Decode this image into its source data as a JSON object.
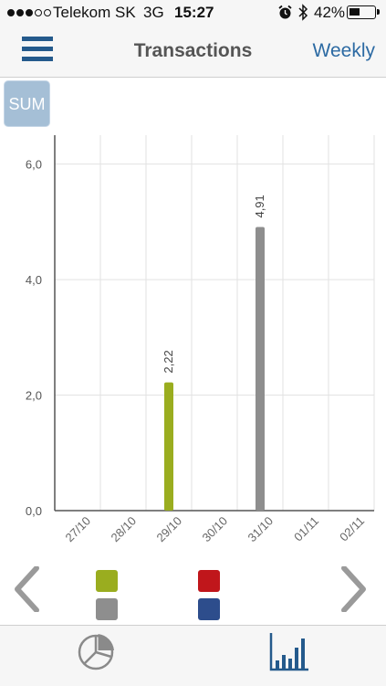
{
  "status_bar": {
    "signal_full": 3,
    "signal_total": 5,
    "carrier": "Telekom SK",
    "network": "3G",
    "time": "15:27",
    "icons": [
      "alarm-icon",
      "bluetooth-icon"
    ],
    "battery_text": "42%",
    "battery_level": 0.42
  },
  "header": {
    "menu_icon": "hamburger-icon",
    "title": "Transactions",
    "period": "Weekly"
  },
  "sum_button": {
    "label": "SUM"
  },
  "chart_data": {
    "type": "bar",
    "categories": [
      "27/10",
      "28/10",
      "29/10",
      "30/10",
      "31/10",
      "01/11",
      "02/11"
    ],
    "series": [
      {
        "color": "#9aad1f",
        "values": [
          0,
          0,
          2.22,
          0,
          0,
          0,
          0
        ]
      },
      {
        "color": "#8e8e8e",
        "values": [
          0,
          0,
          0,
          0,
          4.91,
          0,
          0
        ]
      }
    ],
    "data_labels": [
      {
        "category": "29/10",
        "value": 2.22,
        "text": "2,22"
      },
      {
        "category": "31/10",
        "value": 4.91,
        "text": "4,91"
      }
    ],
    "yticks": [
      "0,0",
      "2,0",
      "4,0",
      "6,0"
    ],
    "ylim": [
      0,
      6.5
    ],
    "grid": true,
    "xlabel": "",
    "ylabel": ""
  },
  "navigation": {
    "prev_icon": "chevron-left-icon",
    "next_icon": "chevron-right-icon"
  },
  "legend": {
    "colors": [
      "#9aad1f",
      "#8e8e8e",
      "#c0161b",
      "#2d4d8c"
    ]
  },
  "tab_bar": {
    "icons": [
      "pie-chart-icon",
      "bar-chart-icon"
    ],
    "active": "bar-chart-icon"
  }
}
